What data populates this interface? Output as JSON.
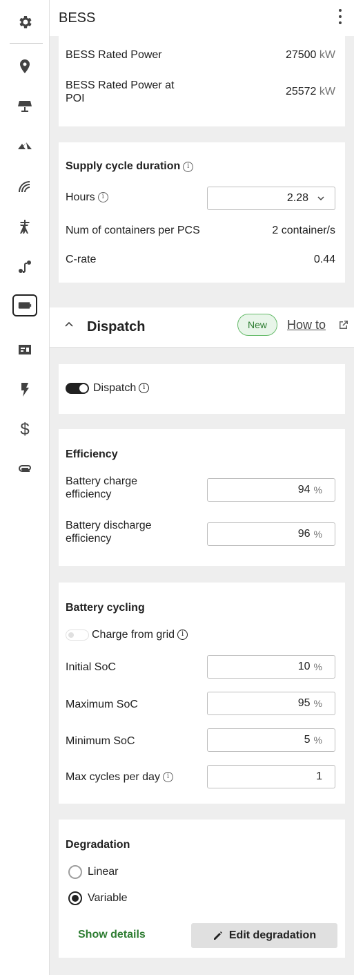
{
  "header": {
    "title": "BESS"
  },
  "rail": {
    "icons": [
      "gear-icon",
      "location-pin-icon",
      "solar-panel-icon",
      "terrain-icon",
      "wind-icon",
      "transmission-tower-icon",
      "route-icon",
      "battery-icon",
      "id-card-icon",
      "lightning-icon",
      "dollar-icon",
      "paperclip-icon"
    ],
    "dollar_glyph": "$"
  },
  "power": {
    "rated_power_label": "BESS Rated Power",
    "rated_power_value": "27500",
    "rated_power_unit": "kW",
    "rated_power_poi_label_line1": "BESS Rated Power at",
    "rated_power_poi_label_line2": "POI",
    "rated_power_poi_value": "25572",
    "rated_power_poi_unit": "kW"
  },
  "supply": {
    "title": "Supply cycle duration",
    "hours_label": "Hours",
    "hours_value": "2.28",
    "containers_label": "Num of containers per PCS",
    "containers_value": "2 container/s",
    "crate_label": "C-rate",
    "crate_value": "0.44"
  },
  "dispatch_bar": {
    "title": "Dispatch",
    "badge": "New",
    "howto": "How to"
  },
  "dispatch_toggle": {
    "label": "Dispatch"
  },
  "efficiency": {
    "title": "Efficiency",
    "charge_label_line1": "Battery charge",
    "charge_label_line2": "efficiency",
    "charge_value": "94",
    "discharge_label_line1": "Battery discharge",
    "discharge_label_line2": "efficiency",
    "discharge_value": "96",
    "unit": "%"
  },
  "cycling": {
    "title": "Battery cycling",
    "charge_from_grid_label": "Charge from grid",
    "initial_soc_label": "Initial SoC",
    "initial_soc_value": "10",
    "max_soc_label": "Maximum SoC",
    "max_soc_value": "95",
    "min_soc_label": "Minimum SoC",
    "min_soc_value": "5",
    "max_cycles_label": "Max cycles per day",
    "max_cycles_value": "1",
    "unit": "%"
  },
  "degradation": {
    "title": "Degradation",
    "linear_label": "Linear",
    "variable_label": "Variable",
    "show_details": "Show details",
    "edit_button": "Edit degradation"
  }
}
